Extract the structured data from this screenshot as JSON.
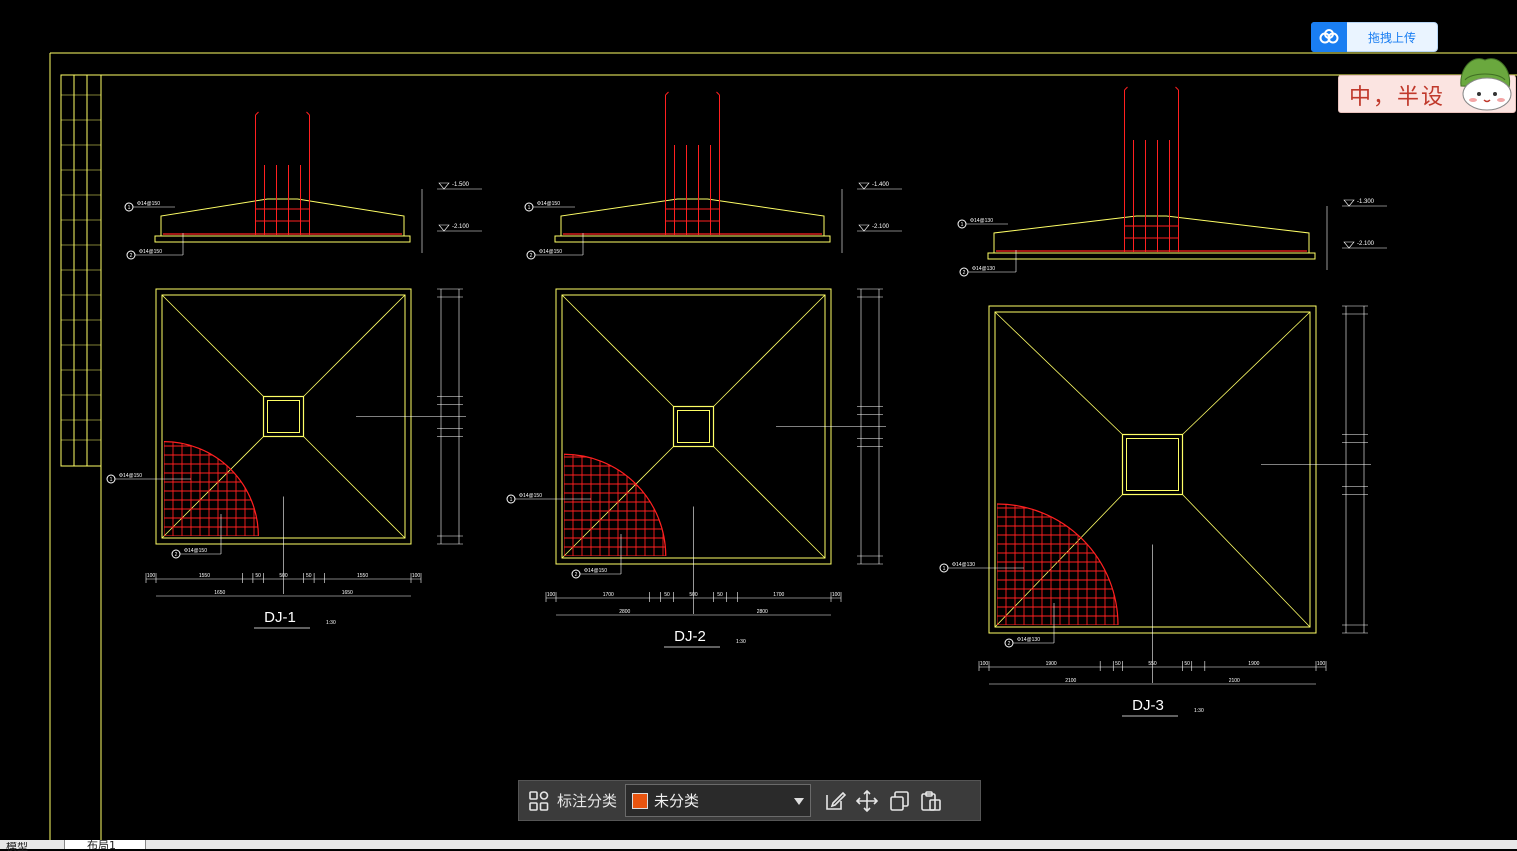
{
  "upload": {
    "label": "拖拽上传",
    "icon": "cloud-icon"
  },
  "watermark": {
    "text": "中，半设",
    "icon": "cat-icon"
  },
  "drawing": {
    "background": "#000000",
    "frame_color": "#ffff66",
    "rebar_color": "#ff2020",
    "foundations": [
      {
        "name": "DJ-1",
        "scale": "1:30",
        "elev_top": "-1.500",
        "elev_bottom": "-2.100",
        "plan_dims_bottom": [
          "100",
          "1550",
          "50",
          "500",
          "50",
          "1550",
          "100"
        ],
        "plan_totals_bottom": [
          "1650",
          "1650"
        ],
        "callout_1": "Φ14@150",
        "callout_2": "Φ14@150"
      },
      {
        "name": "DJ-2",
        "scale": "1:30",
        "elev_top": "-1.400",
        "elev_bottom": "-2.100",
        "plan_dims_bottom": [
          "100",
          "1700",
          "50",
          "500",
          "50",
          "1700",
          "100"
        ],
        "plan_totals_bottom": [
          "2800",
          "2800"
        ],
        "callout_1": "Φ14@150",
        "callout_2": "Φ14@150"
      },
      {
        "name": "DJ-3",
        "scale": "1:30",
        "elev_top": "-1.300",
        "elev_bottom": "-2.100",
        "plan_dims_bottom": [
          "100",
          "1900",
          "50",
          "550",
          "50",
          "1900",
          "100"
        ],
        "plan_totals_bottom": [
          "2100",
          "2100"
        ],
        "callout_1": "Φ14@130",
        "callout_2": "Φ14@130"
      }
    ]
  },
  "toolbar": {
    "grid_icon": "grid-icon",
    "category_label": "标注分类",
    "category_value": "未分类",
    "category_color": "#e8540f",
    "edit_icon": "edit-icon",
    "move_icon": "move-icon",
    "copy_icon": "copy-icon",
    "paste_icon": "paste-icon"
  },
  "tabs": {
    "model": "模型",
    "layout": "布局1"
  }
}
